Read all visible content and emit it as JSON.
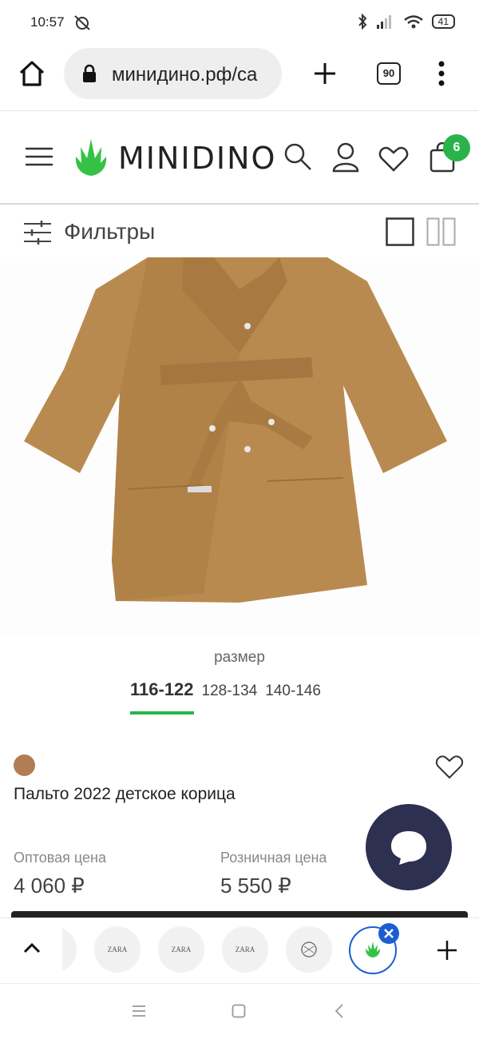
{
  "status_bar": {
    "time": "10:57",
    "battery": "41"
  },
  "browser": {
    "url": "минидино.рф/ca",
    "tab_count": "90"
  },
  "site": {
    "logo": "MINIDINO",
    "cart_count": "6"
  },
  "filters": {
    "label": "Фильтры"
  },
  "product": {
    "size_caption": "размер",
    "sizes": [
      "116-122",
      "128-134",
      "140-146"
    ],
    "selected_size": "116-122",
    "color_hex": "#b07e52",
    "title": "Пальто 2022 детское корица",
    "wholesale_label": "Оптовая цена",
    "wholesale_price": "4 060 ₽",
    "retail_label": "Розничная цена",
    "retail_price": "5 550 ₽"
  },
  "tab_switcher": {
    "tabs": [
      "ZARA",
      "ZARA",
      "ZARA"
    ]
  },
  "colors": {
    "accent": "#2bb34b",
    "chat": "#2d3051"
  }
}
